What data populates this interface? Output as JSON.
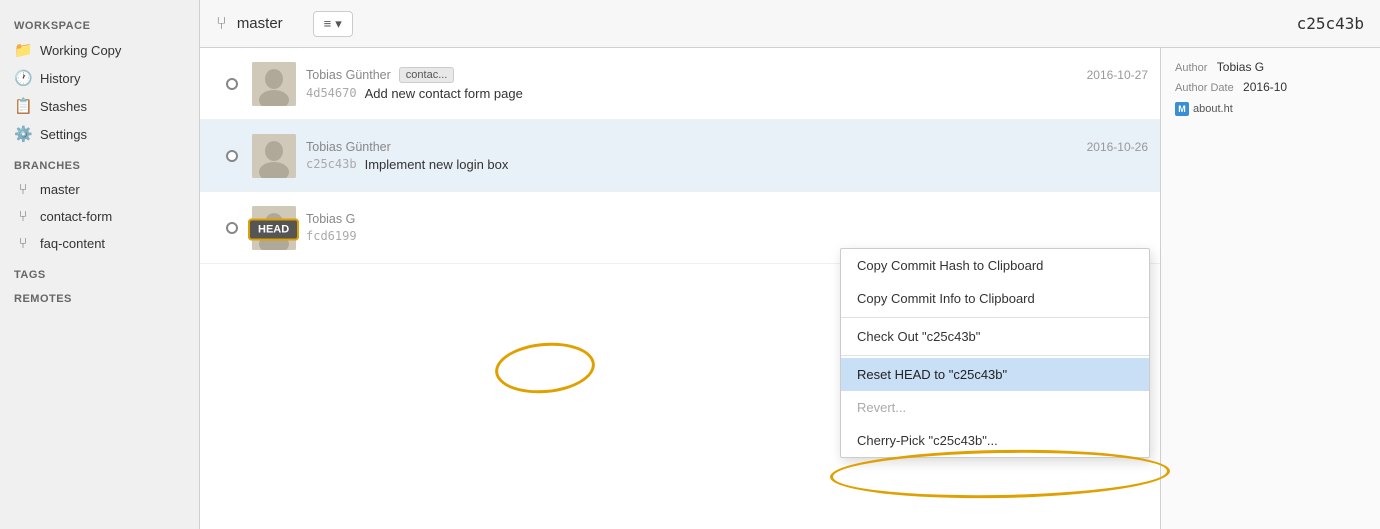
{
  "sidebar": {
    "workspace_label": "Workspace",
    "items": [
      {
        "id": "working-copy",
        "label": "Working Copy",
        "icon": "📁"
      },
      {
        "id": "history",
        "label": "History",
        "icon": "🕐"
      },
      {
        "id": "stashes",
        "label": "Stashes",
        "icon": "📋"
      },
      {
        "id": "settings",
        "label": "Settings",
        "icon": "⚙️"
      }
    ],
    "branches_label": "Branches",
    "branches": [
      {
        "id": "master",
        "label": "master"
      },
      {
        "id": "contact-form",
        "label": "contact-form"
      },
      {
        "id": "faq-content",
        "label": "faq-content"
      }
    ],
    "tags_label": "Tags",
    "remotes_label": "Remotes"
  },
  "toolbar": {
    "branch_icon": "⑂",
    "branch_name": "master",
    "menu_icon": "≡",
    "menu_dropdown": "▾",
    "commit_hash": "c25c43b"
  },
  "commits": [
    {
      "id": "commit-1",
      "author": "Tobias Günther",
      "branch_tag": "contac...",
      "date": "2016-10-27",
      "hash": "4d54670",
      "message": "Add new contact form page",
      "selected": false
    },
    {
      "id": "commit-2",
      "author": "Tobias Günther",
      "branch_tag": "",
      "date": "2016-10-26",
      "hash": "c25c43b",
      "message": "Implement new login box",
      "selected": true
    },
    {
      "id": "commit-3",
      "author": "Tobias G",
      "branch_tag": "",
      "date": "",
      "hash": "fcd6199",
      "message": "",
      "selected": false
    }
  ],
  "head_badge": "HEAD",
  "right_panel": {
    "author_label": "Author",
    "author_value": "Tobias G",
    "author_date_label": "Author Date",
    "author_date_value": "2016-10",
    "files": [
      {
        "badge": "M",
        "name": "about.ht"
      }
    ]
  },
  "context_menu": {
    "items": [
      {
        "id": "copy-hash",
        "label": "Copy Commit Hash to Clipboard",
        "disabled": false,
        "highlighted": false
      },
      {
        "id": "copy-info",
        "label": "Copy Commit Info to Clipboard",
        "disabled": false,
        "highlighted": false
      },
      {
        "id": "divider1",
        "type": "divider"
      },
      {
        "id": "checkout",
        "label": "Check Out \"c25c43b\"",
        "disabled": false,
        "highlighted": false
      },
      {
        "id": "divider2",
        "type": "divider"
      },
      {
        "id": "reset-head",
        "label": "Reset HEAD to \"c25c43b\"",
        "disabled": false,
        "highlighted": true
      },
      {
        "id": "revert",
        "label": "Revert...",
        "disabled": true,
        "highlighted": false
      },
      {
        "id": "cherry-pick",
        "label": "Cherry-Pick \"c25c43b\"...",
        "disabled": false,
        "highlighted": false
      }
    ]
  }
}
